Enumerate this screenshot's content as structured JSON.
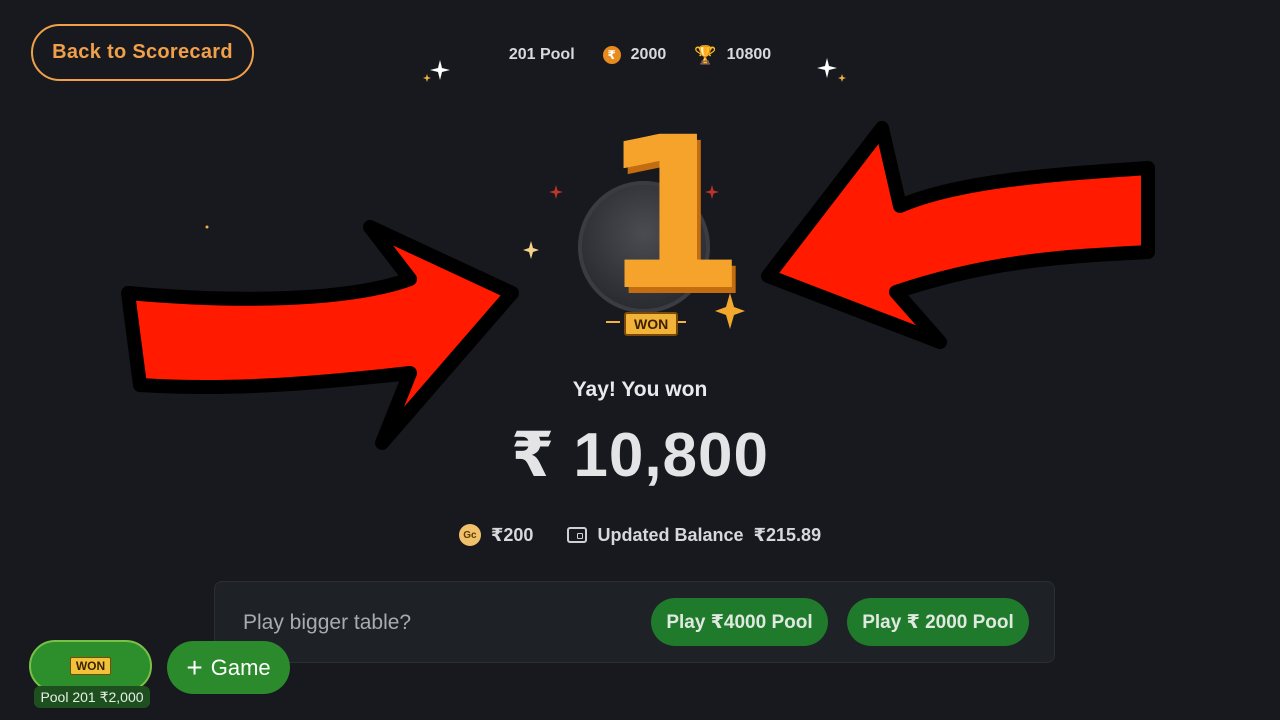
{
  "header": {
    "back_label": "Back to Scorecard",
    "game_name": "201 Pool",
    "entry_fee": "2000",
    "prize": "10800",
    "icons": {
      "entry": "rupee-coin-icon",
      "prize": "trophy-icon"
    }
  },
  "badge": {
    "rank": "1",
    "tag": "WON"
  },
  "result": {
    "message": "Yay! You won",
    "amount": "₹ 10,800"
  },
  "balance": {
    "bonus_coin_label": "Gc",
    "bonus": "₹200",
    "updated_label": "Updated Balance",
    "updated_value": "₹215.89"
  },
  "upsell": {
    "prompt": "Play bigger table?",
    "options": [
      {
        "label": "Play ₹4000 Pool"
      },
      {
        "label": "Play ₹ 2000 Pool"
      }
    ]
  },
  "footer": {
    "won_tag": "WON",
    "pool_label": "Pool 201 ₹2,000",
    "game_plus": "+",
    "game_label": "Game"
  },
  "colors": {
    "background": "#17191e",
    "accent_orange": "#f0a04a",
    "green_button": "#1f7a2c",
    "arrow_red": "#ff1a00"
  }
}
